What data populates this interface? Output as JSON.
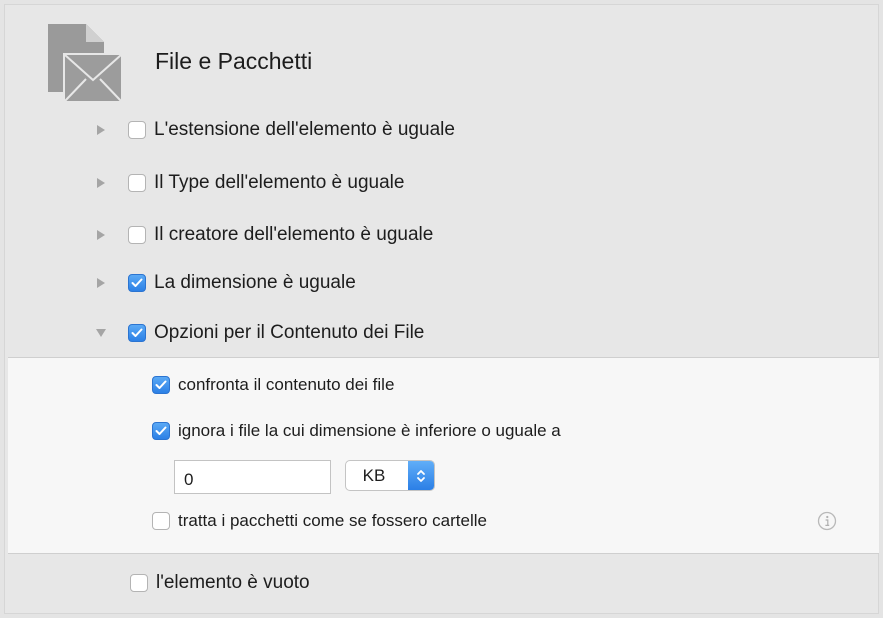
{
  "header": {
    "title": "File e Pacchetti",
    "icon": "file-mail-icon"
  },
  "rules": [
    {
      "label": "L'estensione dell'elemento è uguale",
      "checked": false,
      "expanded": false
    },
    {
      "label": "Il Type dell'elemento è uguale",
      "checked": false,
      "expanded": false
    },
    {
      "label": "Il creatore dell'elemento è uguale",
      "checked": false,
      "expanded": false
    },
    {
      "label": "La dimensione  è uguale",
      "checked": true,
      "expanded": false
    },
    {
      "label": "Opzioni per il Contenuto dei File",
      "checked": true,
      "expanded": true
    }
  ],
  "content_options": {
    "compare_contents": {
      "label": "confronta il contenuto dei file",
      "checked": true
    },
    "ignore_small": {
      "label": "ignora i file la cui dimensione è inferiore o uguale a",
      "checked": true
    },
    "size_value": "0",
    "size_unit": "KB",
    "treat_packages": {
      "label": "tratta i pacchetti come se fossero cartelle",
      "checked": false
    }
  },
  "empty_item": {
    "label": "l'elemento è vuoto",
    "checked": false
  },
  "colors": {
    "accent": "#2c80e6",
    "panel_bg": "#f7f7f7",
    "window_bg": "#e7e7e7"
  }
}
